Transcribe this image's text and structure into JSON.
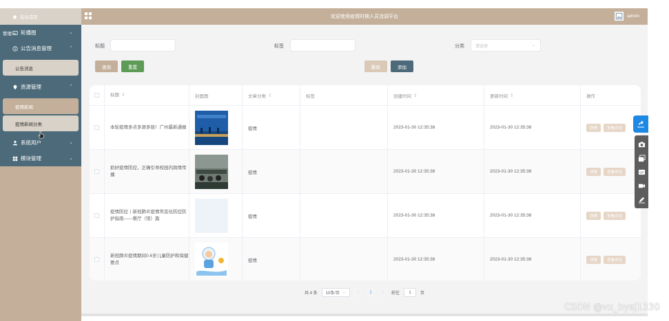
{
  "header": {
    "title": "欢迎使用疫情时期人员流调平台",
    "username": "admin"
  },
  "sidebar": {
    "home": "后台首页",
    "carousel": "轮播图",
    "carousel_prefix": "管理",
    "notice_group": "公告消息管理",
    "notice_item": "公告消息",
    "resource_group": "资源管理",
    "resource_items": [
      "疫情新闻",
      "疫情新闻分类"
    ],
    "users_group": "系统用户",
    "module_group": "模块管理"
  },
  "filter": {
    "title_label": "标题",
    "tag_label": "标签",
    "category_label": "分类",
    "category_placeholder": "请选择",
    "search_button": "查询",
    "reset_button": "重置",
    "delete_button": "删除",
    "add_button": "添加"
  },
  "table": {
    "headers": {
      "title": "标题",
      "cover": "封面图",
      "category": "文章分类",
      "tags": "标签",
      "created": "创建时间",
      "updated": "更新时间",
      "actions": "操作"
    },
    "rows": [
      {
        "title": "本轮疫情多点多源多链！广州最新通报",
        "category": "疫情",
        "tags": "",
        "created": "2023-01-30 12:35:38",
        "updated": "2023-01-30 12:35:38"
      },
      {
        "title": "抓好疫情防控，正确引导校园内舆情传播",
        "category": "疫情",
        "tags": "",
        "created": "2023-01-30 12:35:38",
        "updated": "2023-01-30 12:35:38"
      },
      {
        "title": "疫情防控丨新冠肺炎疫情常态化防控防护指南——餐厅（馆）篇",
        "category": "疫情",
        "tags": "",
        "created": "2023-01-30 12:35:38",
        "updated": "2023-01-30 12:35:38"
      },
      {
        "title": "新冠肺炎疫情期间0-6岁儿童防护和保健要点",
        "category": "疫情",
        "tags": "",
        "created": "2023-01-30 12:35:38",
        "updated": "2023-01-30 12:35:38"
      }
    ],
    "action_detail": "详情",
    "action_comment": "查看评论"
  },
  "pager": {
    "total": "共 4 条",
    "page_size": "10条/页",
    "current_page": "1",
    "goto_label": "前往",
    "goto_value": "1",
    "page_unit": "页"
  },
  "watermark": "CSDN @vx_bysj1330",
  "colors": {
    "sidebar_dark": "#4c6a79",
    "accent_tan": "#c4b09a",
    "search_btn": "#c4b09a",
    "reset_btn": "#5e9b57",
    "add_btn": "#4c6a79"
  }
}
